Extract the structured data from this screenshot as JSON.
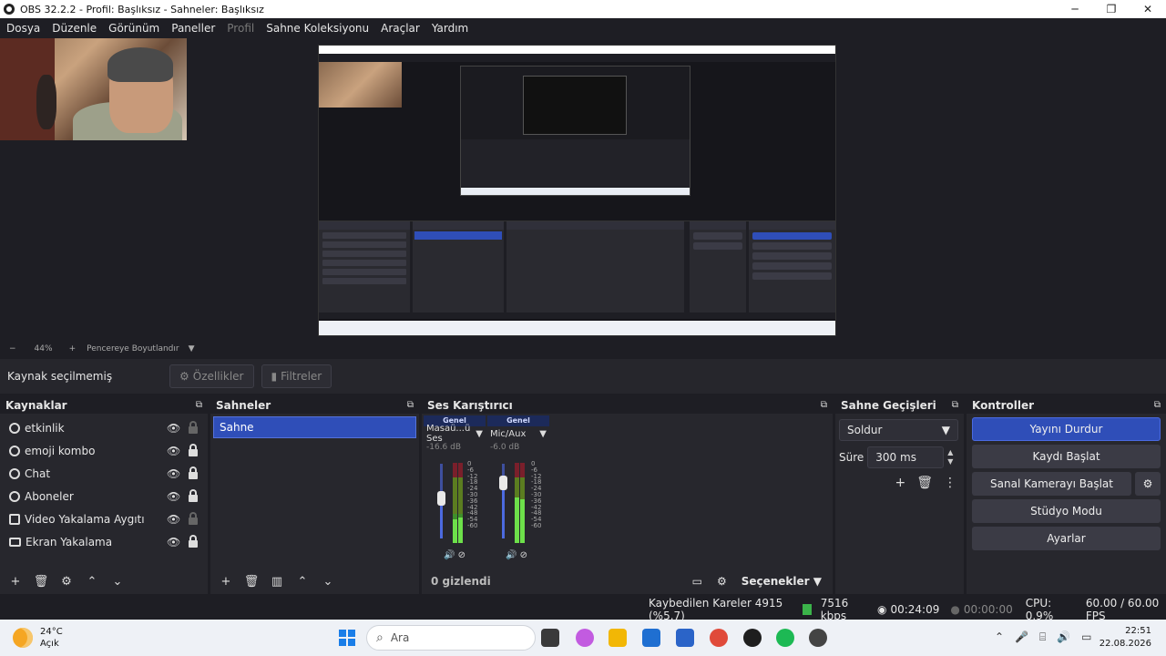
{
  "window": {
    "title": "OBS 32.2.2 - Profil: Başlıksız - Sahneler: Başlıksız",
    "buttons": [
      "─",
      "❐",
      "✕"
    ]
  },
  "menu": {
    "items": [
      "Dosya",
      "Düzenle",
      "Görünüm",
      "Paneller",
      "Profil",
      "Sahne Koleksiyonu",
      "Araçlar",
      "Yardım"
    ]
  },
  "zoombar": {
    "minus": "−",
    "zoom": "44%",
    "plus": "+",
    "fit_label": "Pencereye Boyutlandır"
  },
  "source_bar": {
    "no_source": "Kaynak seçilmemiş",
    "properties": "Özellikler",
    "filters": "Filtreler"
  },
  "sources": {
    "title": "Kaynaklar",
    "items": [
      {
        "name": "etkinlik",
        "icon": "browser-icon",
        "locked": false
      },
      {
        "name": "emoji kombo",
        "icon": "browser-icon",
        "locked": true
      },
      {
        "name": "Chat",
        "icon": "browser-icon",
        "locked": true
      },
      {
        "name": "Aboneler",
        "icon": "browser-icon",
        "locked": true
      },
      {
        "name": "Video Yakalama Aygıtı",
        "icon": "camera-icon",
        "locked": false
      },
      {
        "name": "Ekran Yakalama",
        "icon": "monitor-icon",
        "locked": true
      }
    ]
  },
  "scenes": {
    "title": "Sahneler",
    "items": [
      "Sahne"
    ]
  },
  "mixer": {
    "title": "Ses Karıştırıcı",
    "channels": [
      {
        "category": "Genel",
        "name": "Masaü...ü Ses",
        "db": "-16.6 dB"
      },
      {
        "category": "Genel",
        "name": "Mic/Aux",
        "db": "-6.0 dB"
      }
    ],
    "scale": [
      "0",
      "-6",
      "-12",
      "-18",
      "-24",
      "-30",
      "-36",
      "-42",
      "-48",
      "-54",
      "-60"
    ],
    "hidden_count": "0 gizlendi",
    "options": "Seçenekler"
  },
  "transitions": {
    "title": "Sahne Geçişleri",
    "selected": "Soldur",
    "duration_label": "Süre",
    "duration_value": "300 ms"
  },
  "controls": {
    "title": "Kontroller",
    "stop_stream": "Yayını Durdur",
    "start_record": "Kaydı Başlat",
    "virtual_cam": "Sanal Kamerayı Başlat",
    "studio_mode": "Stüdyo Modu",
    "settings": "Ayarlar"
  },
  "status": {
    "dropped_frames": "Kaybedilen Kareler 4915 (%5.7)",
    "bitrate": "7516 kbps",
    "stream_time": "00:24:09",
    "record_time": "00:00:00",
    "cpu": "CPU: 0.9%",
    "fps": "60.00 / 60.00 FPS"
  },
  "taskbar": {
    "temp": "24°C",
    "weather": "Açık",
    "search": "Ara",
    "time": "22:51",
    "date": "22.08.2026"
  },
  "colors": {
    "accent": "#2f4eb8",
    "background": "#1e1e24",
    "dock": "#27272d"
  }
}
